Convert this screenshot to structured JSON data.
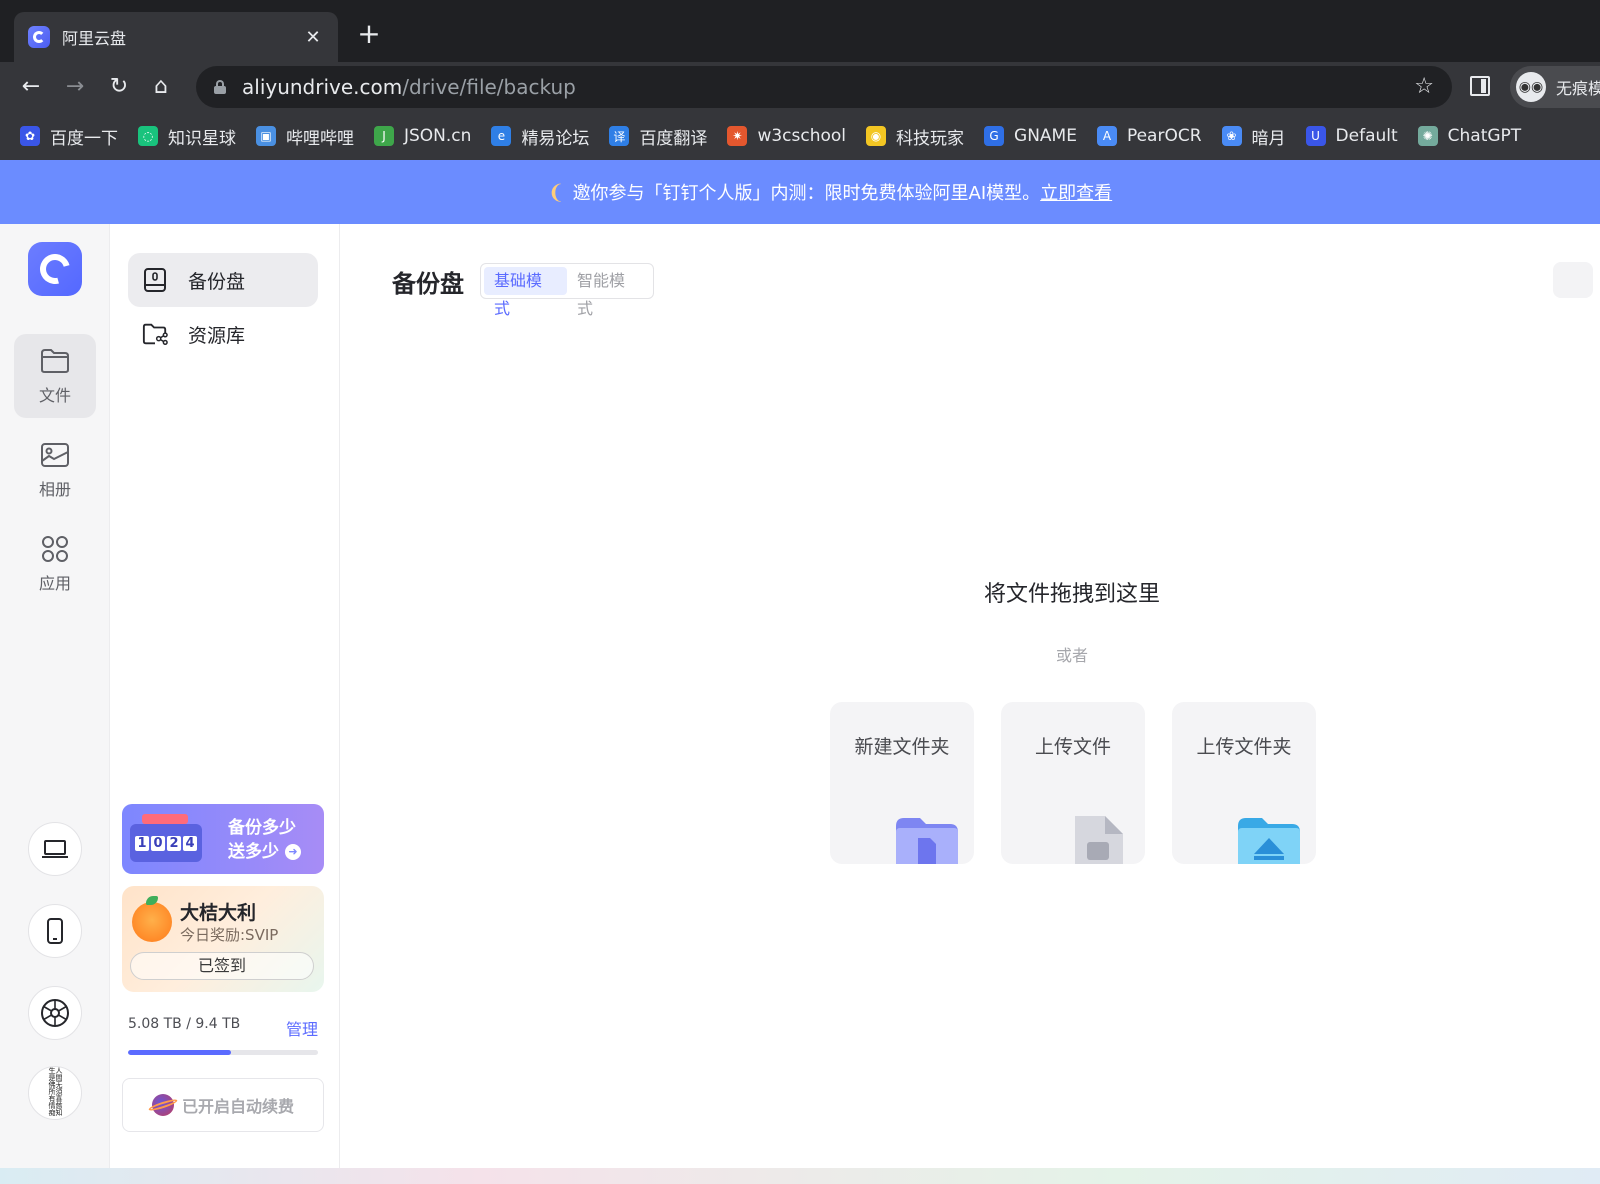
{
  "browser": {
    "tab_title": "阿里云盘",
    "tab_close": "✕",
    "new_tab": "+",
    "url_host": "aliyundrive.com",
    "url_path": "/drive/file/backup",
    "incognito_label": "无痕模式",
    "bookmarks": [
      {
        "label": "百度一下",
        "icon": "baidu-icon",
        "color": "#3a56e8",
        "glyph": "✿"
      },
      {
        "label": "知识星球",
        "icon": "zsxq-icon",
        "color": "#19c37d",
        "glyph": "◌"
      },
      {
        "label": "哔哩哔哩",
        "icon": "bilibili-icon",
        "color": "#4a90e2",
        "glyph": "▣"
      },
      {
        "label": "JSON.cn",
        "icon": "json-icon",
        "color": "#3ea64a",
        "glyph": "J"
      },
      {
        "label": "精易论坛",
        "icon": "jingyi-icon",
        "color": "#2f7fe6",
        "glyph": "e"
      },
      {
        "label": "百度翻译",
        "icon": "translate-icon",
        "color": "#2f7fe6",
        "glyph": "译"
      },
      {
        "label": "w3cschool",
        "icon": "w3cschool-icon",
        "color": "#e4572e",
        "glyph": "✷"
      },
      {
        "label": "科技玩家",
        "icon": "bulb-icon",
        "color": "#f3c623",
        "glyph": "◉"
      },
      {
        "label": "GNAME",
        "icon": "gname-icon",
        "color": "#2f6fe6",
        "glyph": "G"
      },
      {
        "label": "PearOCR",
        "icon": "pearocr-icon",
        "color": "#4a8bf5",
        "glyph": "A"
      },
      {
        "label": "暗月",
        "icon": "anyue-icon",
        "color": "#4a8bf5",
        "glyph": "❀"
      },
      {
        "label": "Default",
        "icon": "default-icon",
        "color": "#3a56e8",
        "glyph": "U"
      },
      {
        "label": "ChatGPT",
        "icon": "chatgpt-icon",
        "color": "#74aa9c",
        "glyph": "✺"
      }
    ]
  },
  "banner": {
    "text": "邀你参与「钉钉个人版」内测：限时免费体验阿里AI模型。",
    "link": "立即查看"
  },
  "rail": {
    "items": [
      {
        "label": "文件"
      },
      {
        "label": "相册"
      },
      {
        "label": "应用"
      }
    ],
    "avatar_text": "人間无須喜慈知生是佛所有情痴"
  },
  "sidebar": {
    "items": [
      {
        "label": "备份盘"
      },
      {
        "label": "资源库"
      }
    ],
    "promo": {
      "digits": [
        "1",
        "0",
        "2",
        "4"
      ],
      "line1": "备份多少",
      "line2": "送多少"
    },
    "checkin": {
      "title": "大桔大利",
      "subtitle": "今日奖励:SVIP",
      "button": "已签到"
    },
    "storage": {
      "used_text": "5.08 TB / 9.4 TB",
      "manage": "管理",
      "used_fraction": 0.54
    },
    "autorenew": "已开启自动续费"
  },
  "main": {
    "title": "备份盘",
    "modes": [
      "基础模式",
      "智能模式"
    ],
    "drop_title": "将文件拖拽到这里",
    "drop_or": "或者",
    "actions": [
      {
        "label": "新建文件夹"
      },
      {
        "label": "上传文件"
      },
      {
        "label": "上传文件夹"
      }
    ]
  },
  "colors": {
    "accent": "#5b6bff",
    "banner": "#6b8cff"
  }
}
